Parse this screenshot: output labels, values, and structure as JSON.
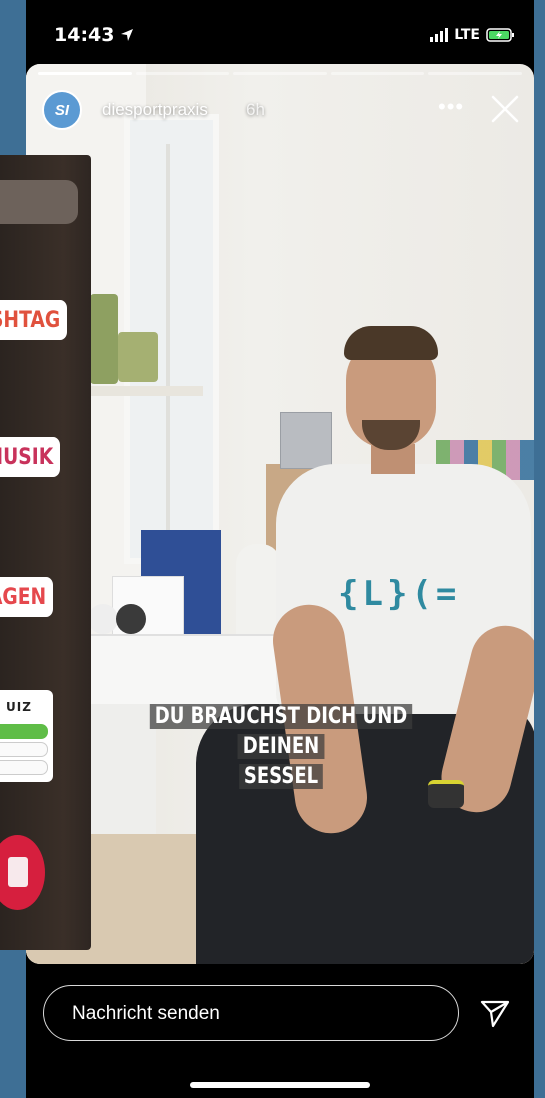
{
  "status_bar": {
    "time": "14:43",
    "network": "LTE"
  },
  "story": {
    "username": "diesportpraxis",
    "time_ago": "6h",
    "avatar_text": "SI",
    "caption_line1": "DU BRAUCHST DICH UND DEINEN",
    "caption_line2": "SESSEL",
    "shirt_logo": "{L}(=",
    "segments": 5
  },
  "reply": {
    "placeholder": "Nachricht senden"
  },
  "sticker_tray": {
    "hashtag_label": "SHTAG",
    "music_label": "MUSIK",
    "questions_label": "AGEN",
    "quiz_label": "UIZ"
  },
  "colors": {
    "background": "#3e6f95",
    "accent_quiz": "#5fbd47"
  }
}
